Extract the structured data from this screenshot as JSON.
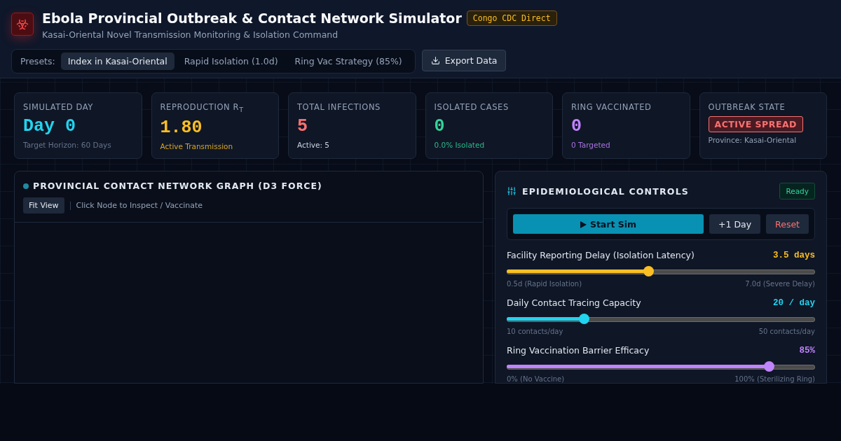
{
  "header": {
    "title": "Ebola Provincial Outbreak & Contact Network Simulator",
    "badge": "Congo CDC Direct",
    "subtitle": "Kasai-Oriental Novel Transmission Monitoring & Isolation Command"
  },
  "presets": {
    "label": "Presets:",
    "items": [
      {
        "label": "Index in Kasai-Oriental",
        "selected": true
      },
      {
        "label": "Rapid Isolation (1.0d)",
        "selected": false
      },
      {
        "label": "Ring Vac Strategy (85%)",
        "selected": false
      }
    ]
  },
  "export_button": "Export Data",
  "stats": [
    {
      "kind": "value",
      "label": "SIMULATED DAY",
      "value": "Day 0",
      "color": "#22d3ee",
      "note": {
        "kind": "muted",
        "text": "Target Horizon: 60 Days"
      }
    },
    {
      "kind": "value",
      "label": "REPRODUCTION R$_{T}$",
      "value": "1.80",
      "color": "#fbbf24",
      "note": {
        "kind": "accent",
        "text": "Active Transmission"
      }
    },
    {
      "kind": "value",
      "label": "TOTAL INFECTIONS",
      "value": "5",
      "color": "#f87171",
      "note": {
        "kind": "plain",
        "text": "Active: 5"
      }
    },
    {
      "kind": "value",
      "label": "ISOLATED CASES",
      "value": "0",
      "color": "#34d399",
      "note": {
        "kind": "accent",
        "text": "0.0% Isolated"
      }
    },
    {
      "kind": "value",
      "label": "RING VACCINATED",
      "value": "0",
      "color": "#c084fc",
      "note": {
        "kind": "accent",
        "text": "0 Targeted"
      }
    },
    {
      "kind": "badge",
      "label": "OUTBREAK STATE",
      "value": "ACTIVE SPREAD",
      "color": "#f87171",
      "note": {
        "kind": "soft",
        "text": "Province: Kasai-Oriental"
      }
    }
  ],
  "network": {
    "title": "PROVINCIAL CONTACT NETWORK GRAPH (D3 FORCE)",
    "fit_button": "Fit View",
    "hint": "Click Node to Inspect / Vaccinate"
  },
  "controls": {
    "title": "EPIDEMIOLOGICAL CONTROLS",
    "status": "Ready",
    "start_button": "Start Sim",
    "step_button": "+1 Day",
    "reset_button": "Reset",
    "sliders": [
      {
        "label": "Facility Reporting Delay (Isolation Latency)",
        "reading": "3.5 days",
        "level": 0.46,
        "min_label": "0.5d (Rapid Isolation)",
        "max_label": "7.0d (Severe Delay)",
        "color": "#fbbf24"
      },
      {
        "label": "Daily Contact Tracing Capacity",
        "reading": "20 / day",
        "level": 0.25,
        "min_label": "10 contacts/day",
        "max_label": "50 contacts/day",
        "color": "#22d3ee"
      },
      {
        "label": "Ring Vaccination Barrier Efficacy",
        "reading": "85%",
        "level": 0.85,
        "min_label": "0% (No Vaccine)",
        "max_label": "100% (Sterilizing Ring)",
        "color": "#c084fc"
      }
    ]
  }
}
